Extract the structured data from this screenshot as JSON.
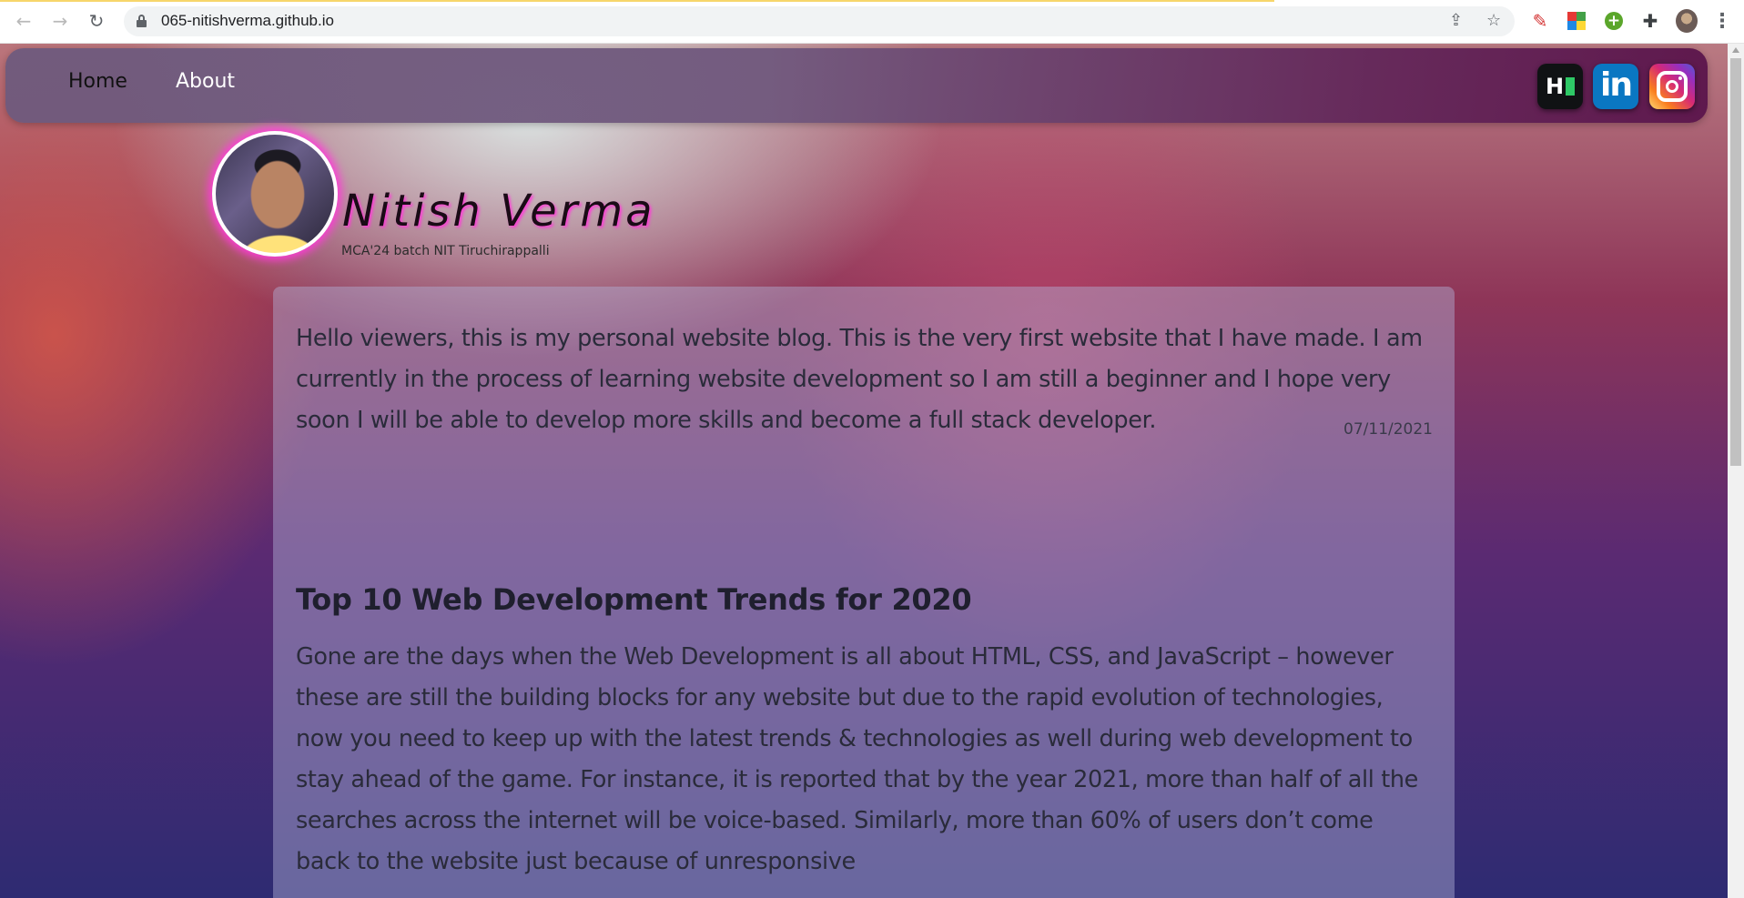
{
  "browser": {
    "url": "065-nitishverma.github.io",
    "icons": [
      "back-icon",
      "forward-icon",
      "reload-icon",
      "lock-icon",
      "share-icon",
      "star-icon",
      "pen-extension-icon",
      "colors-extension-icon",
      "plus-extension-icon",
      "puzzle-extension-icon",
      "profile-avatar",
      "more-menu-icon"
    ]
  },
  "nav": {
    "home_label": "Home",
    "about_label": "About",
    "social": [
      {
        "name": "HackerRank",
        "icon": "hackerrank-icon",
        "glyph": "H"
      },
      {
        "name": "LinkedIn",
        "icon": "linkedin-icon",
        "glyph": "in"
      },
      {
        "name": "Instagram",
        "icon": "instagram-icon"
      }
    ]
  },
  "profile": {
    "name": "Nitish Verma",
    "subtitle": "MCA'24 batch NIT Tiruchirappalli"
  },
  "intro": {
    "text": "Hello viewers, this is my personal website blog. This is the very first website that I have made. I am currently in the process of learning website development so I am still a beginner and I hope very soon I will be able to develop more skills and become a full stack developer.",
    "date": "07/11/2021"
  },
  "post": {
    "title": "Top 10 Web Development Trends for 2020",
    "body": "Gone are the days when the Web Development is all about HTML, CSS, and JavaScript – however these are still the building blocks for any website but due to the rapid evolution of technologies, now you need to keep up with the latest trends & technologies as well during web development to stay ahead of the game. For instance, it is reported that by the year 2021, more than half of all the searches across the internet will be voice-based. Similarly, more than 60% of users don’t come back to the website just because of unresponsive"
  },
  "colors": {
    "accent_glow": "#ff3ad9",
    "hackerrank_green": "#2ec866",
    "linkedin_blue": "#0a77c2"
  }
}
